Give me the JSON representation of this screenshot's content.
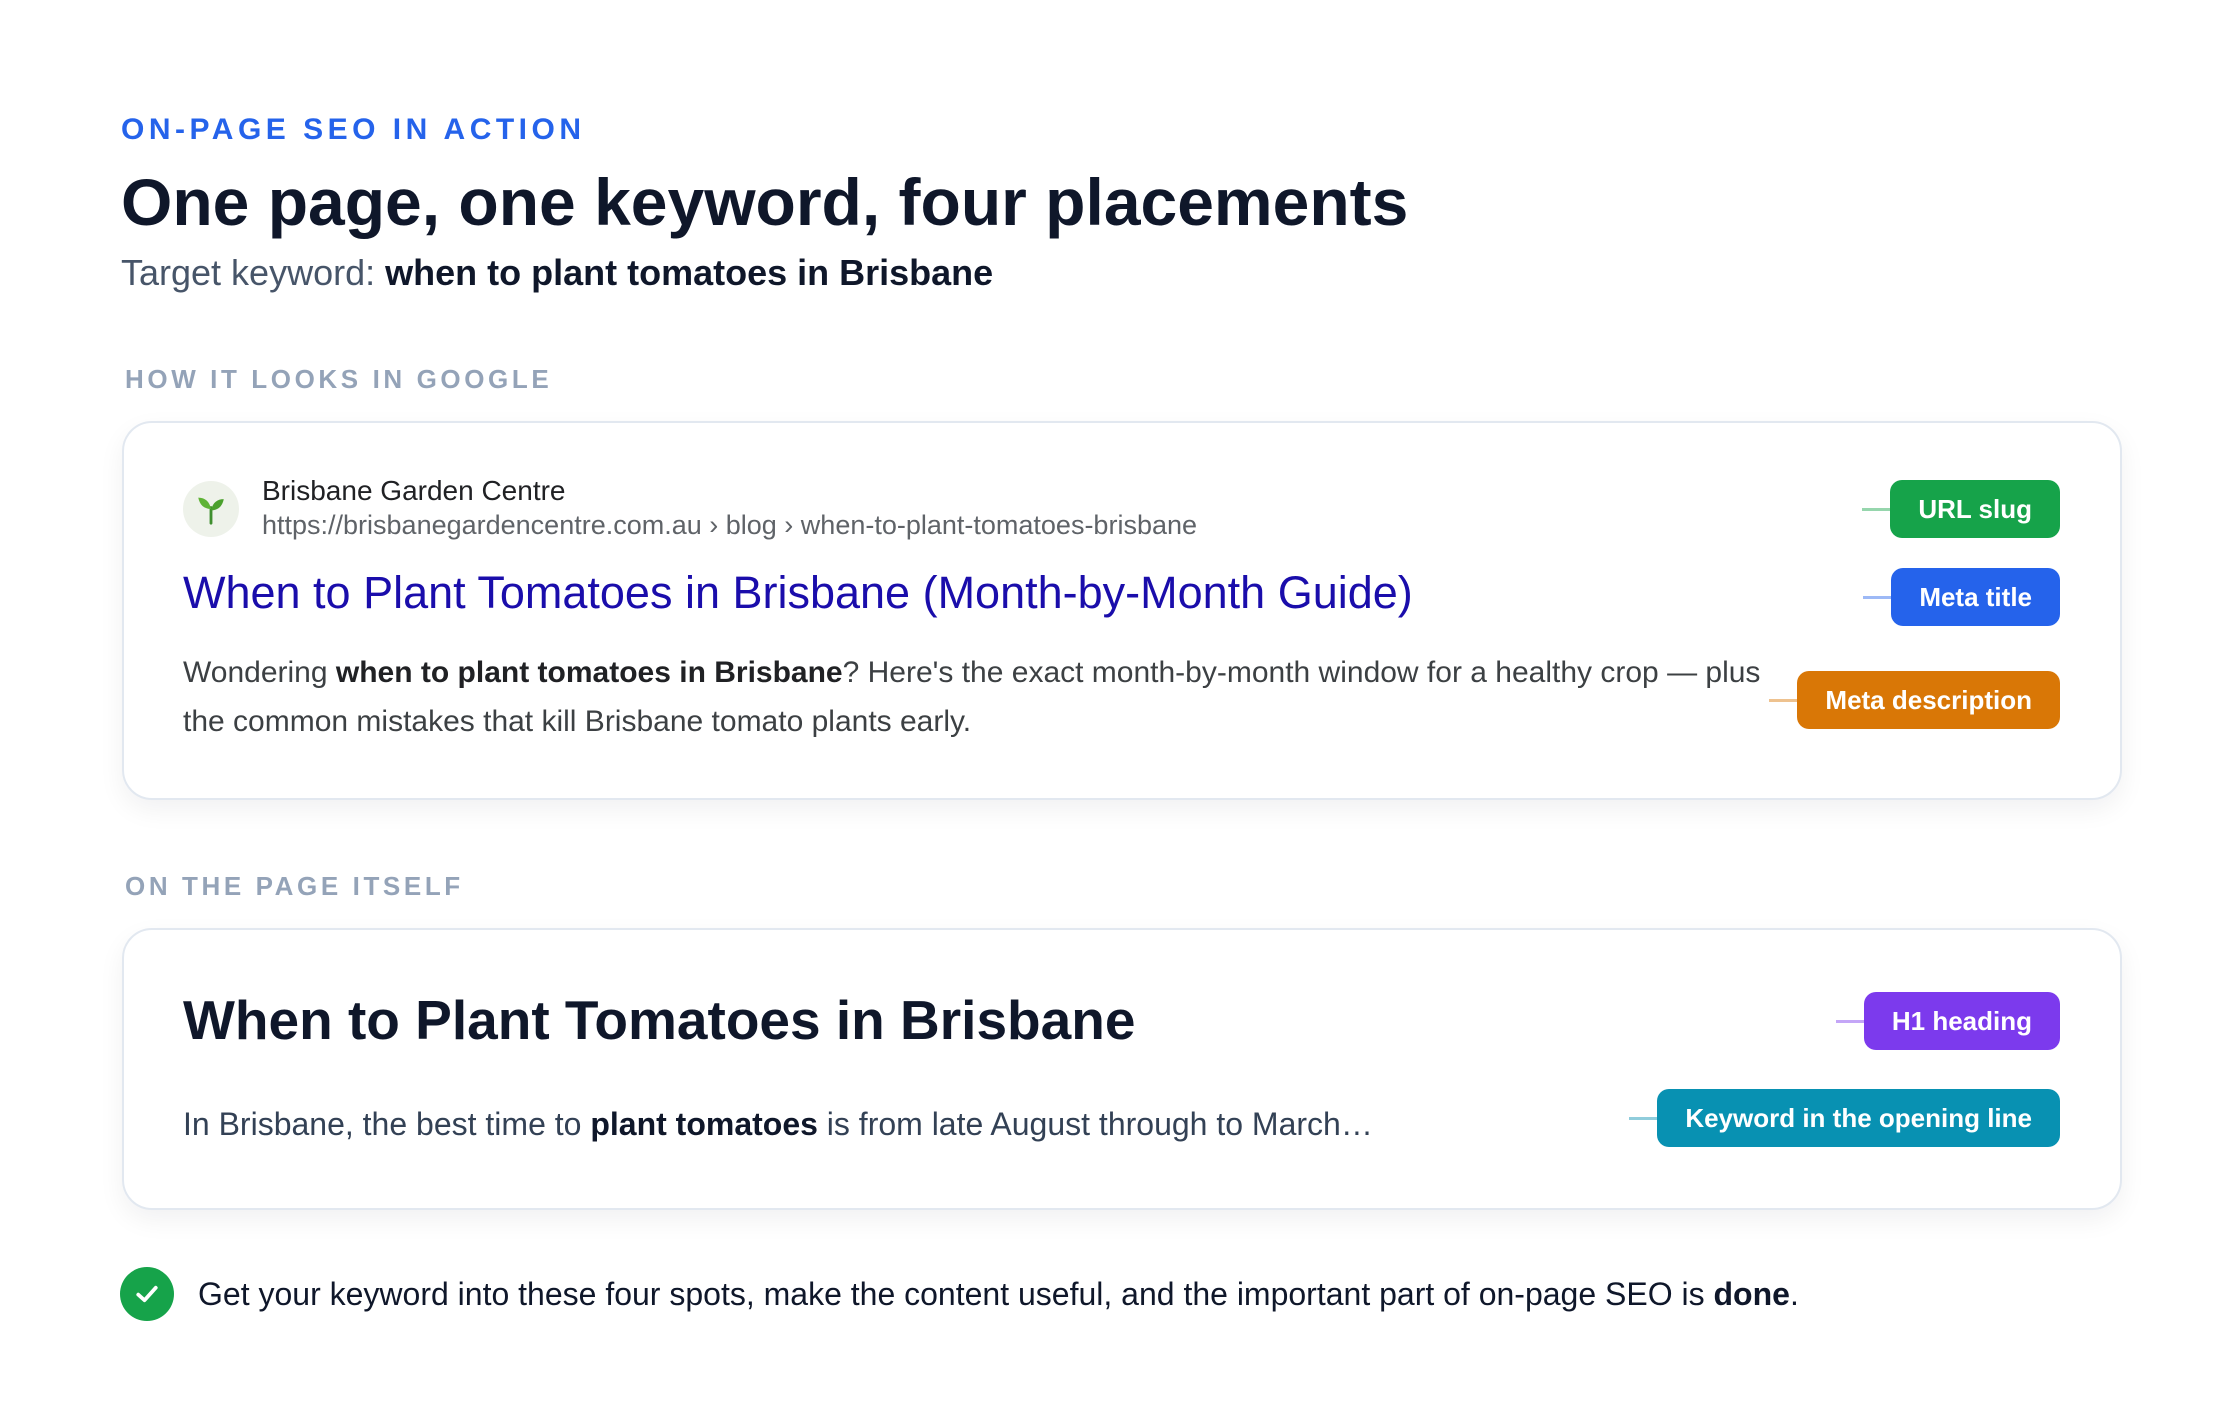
{
  "header": {
    "eyebrow": "ON-PAGE SEO IN ACTION",
    "title": "One page, one keyword, four placements",
    "target_prefix": "Target keyword:",
    "target_keyword": "when to plant tomatoes in Brisbane"
  },
  "serp_section": {
    "label": "HOW IT LOOKS IN GOOGLE",
    "favicon": "seedling-icon",
    "site_name": "Brisbane Garden Centre",
    "url": "https://brisbanegardencentre.com.au › blog › when-to-plant-tomatoes-brisbane",
    "title": "When to Plant Tomatoes in Brisbane (Month-by-Month Guide)",
    "desc_prefix": "Wondering",
    "desc_keyword": "when to plant tomatoes in Brisbane",
    "desc_suffix": "? Here's the exact month-by-month window for a healthy crop — plus the common mistakes that kill Brisbane tomato plants early."
  },
  "page_section": {
    "label": "ON THE PAGE ITSELF",
    "h1": "When to Plant Tomatoes in Brisbane",
    "opening_prefix": "In Brisbane, the best time to",
    "opening_keyword": "plant tomatoes",
    "opening_suffix": "is from late August through to March…"
  },
  "tags": {
    "url_slug": {
      "label": "URL slug",
      "color": "#16a34a"
    },
    "meta_title": {
      "label": "Meta title",
      "color": "#2563eb"
    },
    "meta_description": {
      "label": "Meta description",
      "color": "#d97706"
    },
    "h1_heading": {
      "label": "H1 heading",
      "color": "#7c3aed"
    },
    "opening_line": {
      "label": "Keyword in the opening line",
      "color": "#0891b2"
    }
  },
  "footer": {
    "icon": "check-icon",
    "text_main": "Get your keyword into these four spots, make the content useful, and the important part of on-page SEO is",
    "text_bold": "done",
    "text_end": "."
  }
}
